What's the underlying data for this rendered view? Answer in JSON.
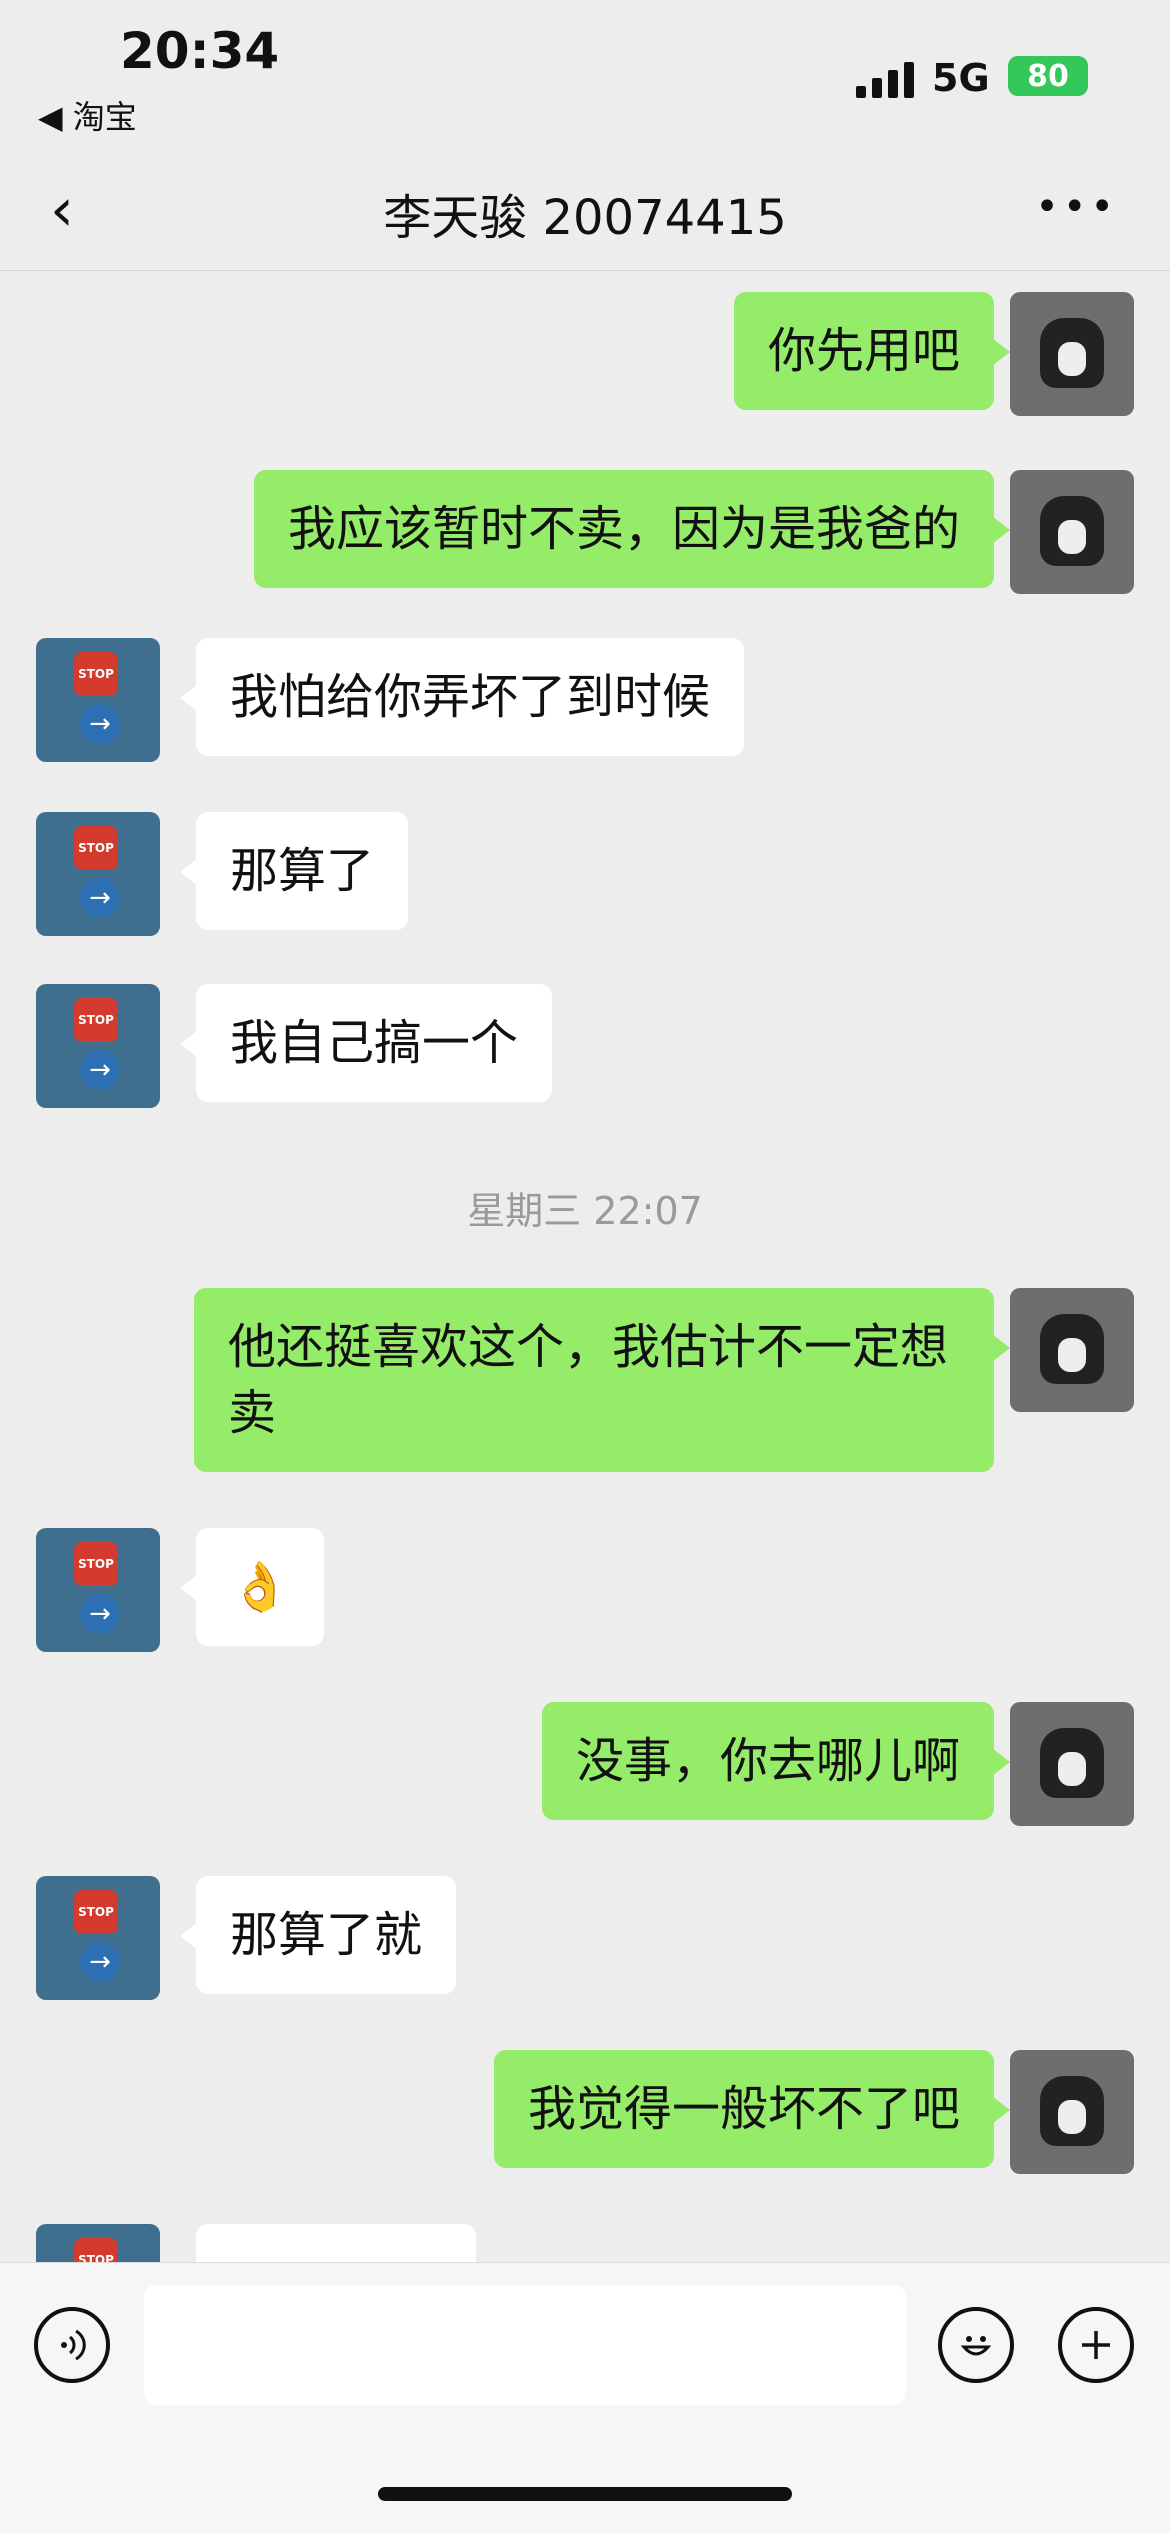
{
  "status_bar": {
    "time": "20:34",
    "back_app": "◀ 淘宝",
    "network": "5G",
    "battery": "80"
  },
  "nav": {
    "back_icon": "‹",
    "title": "李天骏 20074415",
    "more_icon": "•••"
  },
  "messages": [
    {
      "side": "user",
      "text": "你先用吧"
    },
    {
      "side": "user",
      "text": "我应该暂时不卖，因为是我爸的"
    },
    {
      "side": "chat",
      "text": "我怕给你弄坏了到时候"
    },
    {
      "side": "chat",
      "text": "那算了"
    },
    {
      "side": "chat",
      "text": "我自己搞一个"
    },
    {
      "side": "user",
      "text": "他还挺喜欢这个，我估计不一定想卖"
    },
    {
      "side": "chat",
      "text": "👌"
    },
    {
      "side": "user",
      "text": "没事，你去哪儿啊"
    },
    {
      "side": "chat",
      "text": "那算了就"
    },
    {
      "side": "user",
      "text": "我觉得一般坏不了吧"
    }
  ],
  "timestamp": "星期三 22:07",
  "avatar_icons": {
    "user": "cat-avatar",
    "chat": "stop-sign-avatar"
  },
  "input": {
    "value": "",
    "voice_icon": "voice-icon",
    "emoji_icon": "emoji-icon",
    "plus_icon": "plus-icon"
  },
  "colors": {
    "user_bubble": "#95ec69",
    "chat_bubble": "#ffffff",
    "background": "#ededed"
  }
}
